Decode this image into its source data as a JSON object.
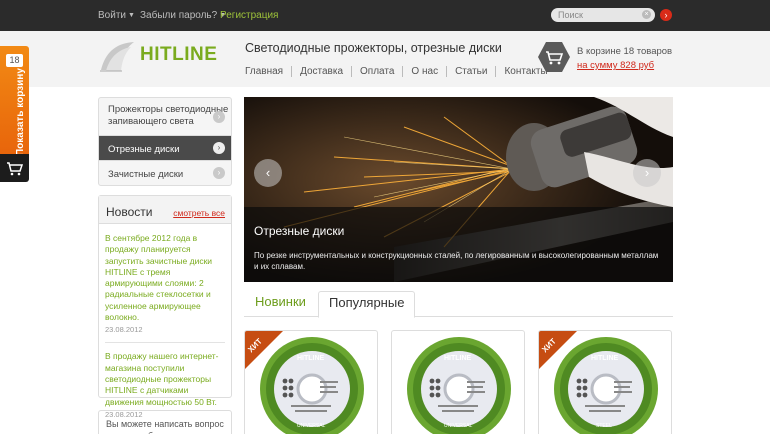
{
  "topbar": {
    "login": "Войти",
    "forgot": "Забыли пароль?",
    "register": "Регистрация",
    "search_placeholder": "Поиск",
    "search_clear": "×",
    "search_go": "›"
  },
  "header": {
    "logo_text": "HITLINE",
    "tagline": "Светодиодные прожекторы, отрезные диски",
    "nav": [
      "Главная",
      "Доставка",
      "Оплата",
      "О нас",
      "Статьи",
      "Контакты"
    ],
    "cart_line1": "В корзине 18 товаров",
    "cart_line2": "на сумму 828 руб"
  },
  "side_tab": {
    "count": "18",
    "label": "Показать корзину"
  },
  "menu": {
    "items": [
      {
        "label_line1": "Прожекторы светодиодные",
        "label_line2": "запивающего света",
        "arrow": "›"
      },
      {
        "label": "Отрезные диски",
        "arrow": "›"
      },
      {
        "label": "Зачистные диски",
        "arrow": "›"
      }
    ]
  },
  "news": {
    "title": "Новости",
    "all_link": "смотреть все",
    "items": [
      {
        "text": "В сентябре 2012 года в продажу планируется запустить зачистные диски HITLINE с тремя армирующими слоями: 2 радиальные стеклосетки и усиленное армирующее волокно.",
        "date": "23.08.2012"
      },
      {
        "text": "В продажу нашего интернет-магазина поступили светодиодные прожекторы HITLINE с датчиками движения мощностью 50 Вт.",
        "date": "23.08.2012"
      }
    ]
  },
  "note": {
    "text": "Вы можете написать вопрос или просьбу, заполнив форму"
  },
  "slider": {
    "title": "Отрезные диски",
    "description": "По резке инструментальных и конструкционных сталей, по легированным и высоколегированным металлам и их сплавам.",
    "prev": "‹",
    "next": "›"
  },
  "tabs": {
    "new_label": "Новинки",
    "popular_label": "Популярные"
  },
  "products": [
    {
      "badge": "ХИТ",
      "brand": "HITLINE",
      "type": "UNIVERSAL"
    },
    {
      "badge": "",
      "brand": "HITLINE",
      "type": "UNIVERSAL"
    },
    {
      "badge": "ХИТ",
      "brand": "HITLINE",
      "type": "STEEL"
    }
  ],
  "colors": {
    "brand_green": "#7aab1e",
    "accent_red": "#d0281b",
    "side_tab_orange": "#f07a12",
    "topbar": "#2b2b2b"
  }
}
